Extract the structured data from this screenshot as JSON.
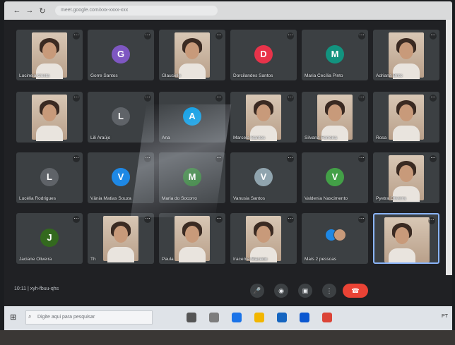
{
  "browser": {
    "back_icon": "←",
    "forward_icon": "→",
    "reload_icon": "↻",
    "address": "meet.google.com/xxx-xxxx-xxx"
  },
  "participants": [
    {
      "name": "Lucineia Costa",
      "type": "photo"
    },
    {
      "name": "Gorre Santos",
      "type": "avatar",
      "initial": "G",
      "color": "#7e57c2"
    },
    {
      "name": "Glauciele",
      "type": "photo"
    },
    {
      "name": "Dorcilandes Santos",
      "type": "avatar",
      "initial": "D",
      "color": "#e8334a"
    },
    {
      "name": "Maria Cecília Pinto",
      "type": "avatar",
      "initial": "M",
      "color": "#12937f"
    },
    {
      "name": "Adriana Brito",
      "type": "photo"
    },
    {
      "name": "",
      "type": "photo"
    },
    {
      "name": "Lili Araújo",
      "type": "avatar",
      "initial": "L",
      "color": "#5f6368"
    },
    {
      "name": "Ana",
      "type": "avatar",
      "initial": "A",
      "color": "#039be5"
    },
    {
      "name": "Marcela Santos",
      "type": "photo"
    },
    {
      "name": "Silvana Ferreira",
      "type": "photo"
    },
    {
      "name": "Rosa",
      "type": "photo"
    },
    {
      "name": "Lucélia Rodrigues",
      "type": "avatar",
      "initial": "L",
      "color": "#5f6368"
    },
    {
      "name": "Vânia Matias Souza",
      "type": "avatar",
      "initial": "V",
      "color": "#1e88e5"
    },
    {
      "name": "Maria do Socorro",
      "type": "avatar",
      "initial": "M",
      "color": "#2e7d32"
    },
    {
      "name": "Vanusia Santos",
      "type": "avatar",
      "initial": "V",
      "color": "#90a4ae"
    },
    {
      "name": "Valdenia Nascimento",
      "type": "avatar",
      "initial": "V",
      "color": "#43a047"
    },
    {
      "name": "Pyetra Oliveira",
      "type": "photo"
    },
    {
      "name": "Jaciane Oliveira",
      "type": "avatar",
      "initial": "J",
      "color": "#33691e"
    },
    {
      "name": "Th",
      "type": "photo"
    },
    {
      "name": "Paula",
      "type": "photo"
    },
    {
      "name": "Iracema Macedo",
      "type": "photo"
    },
    {
      "name": "Mais 2 pessoas",
      "type": "more"
    },
    {
      "name": "",
      "type": "self"
    }
  ],
  "controls": {
    "meeting_info": "10:11 | xyh-fbuu-qhs",
    "mic_icon": "🎤",
    "camera_icon": "◉",
    "present_icon": "▣",
    "more_icon": "⋮",
    "hangup_icon": "☎"
  },
  "taskbar": {
    "start_icon": "⊞",
    "search_placeholder": "Digite aqui para pesquisar",
    "tray_text": "PT"
  },
  "colors": {
    "tile_bg": "#3c4043",
    "stage_bg": "#202124",
    "hangup": "#ea4335",
    "self_border": "#8ab4f8"
  }
}
